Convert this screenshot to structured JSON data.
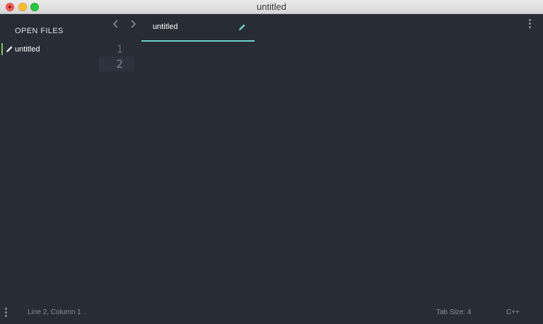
{
  "window": {
    "title": "untitled"
  },
  "sidebar": {
    "heading": "OPEN FILES",
    "items": [
      {
        "label": "untitled",
        "icon": "pencil-icon",
        "accent": "#7fc45b"
      }
    ]
  },
  "tabs": [
    {
      "label": "untitled",
      "icon": "pencil-icon",
      "active": true,
      "underline_color": "#6fd3c8"
    }
  ],
  "editor": {
    "line_numbers": [
      "1",
      "2"
    ],
    "active_line": "2"
  },
  "statusbar": {
    "position": "Line 2, Column 1",
    "tab_size": "Tab Size: 4",
    "syntax": "C++"
  },
  "colors": {
    "background": "#272c35",
    "accent_green": "#7fc45b",
    "accent_teal": "#6fd3c8"
  }
}
